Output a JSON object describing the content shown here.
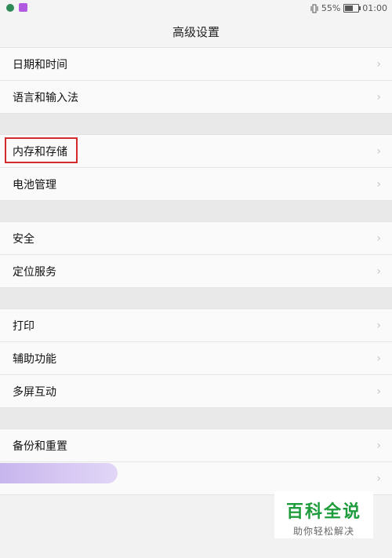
{
  "status_bar": {
    "battery_percent": "55%",
    "time": "01:00",
    "icons": [
      "app-notification-icon",
      "app-notification-icon-2",
      "vibrate-icon",
      "battery-icon"
    ]
  },
  "header": {
    "title": "高级设置"
  },
  "groups": [
    {
      "items": [
        {
          "label": "日期和时间"
        },
        {
          "label": "语言和输入法"
        }
      ]
    },
    {
      "items": [
        {
          "label": "内存和存储"
        },
        {
          "label": "电池管理"
        }
      ]
    },
    {
      "items": [
        {
          "label": "安全"
        },
        {
          "label": "定位服务"
        }
      ]
    },
    {
      "items": [
        {
          "label": "打印"
        },
        {
          "label": "辅助功能"
        },
        {
          "label": "多屏互动"
        }
      ]
    },
    {
      "items": [
        {
          "label": "备份和重置"
        },
        {
          "label": ""
        }
      ]
    }
  ],
  "watermark": {
    "title": "百科全说",
    "subtitle": "助你轻松解决"
  },
  "colors": {
    "highlight": "#d42a2a",
    "watermark_green": "#1e9c3c"
  }
}
